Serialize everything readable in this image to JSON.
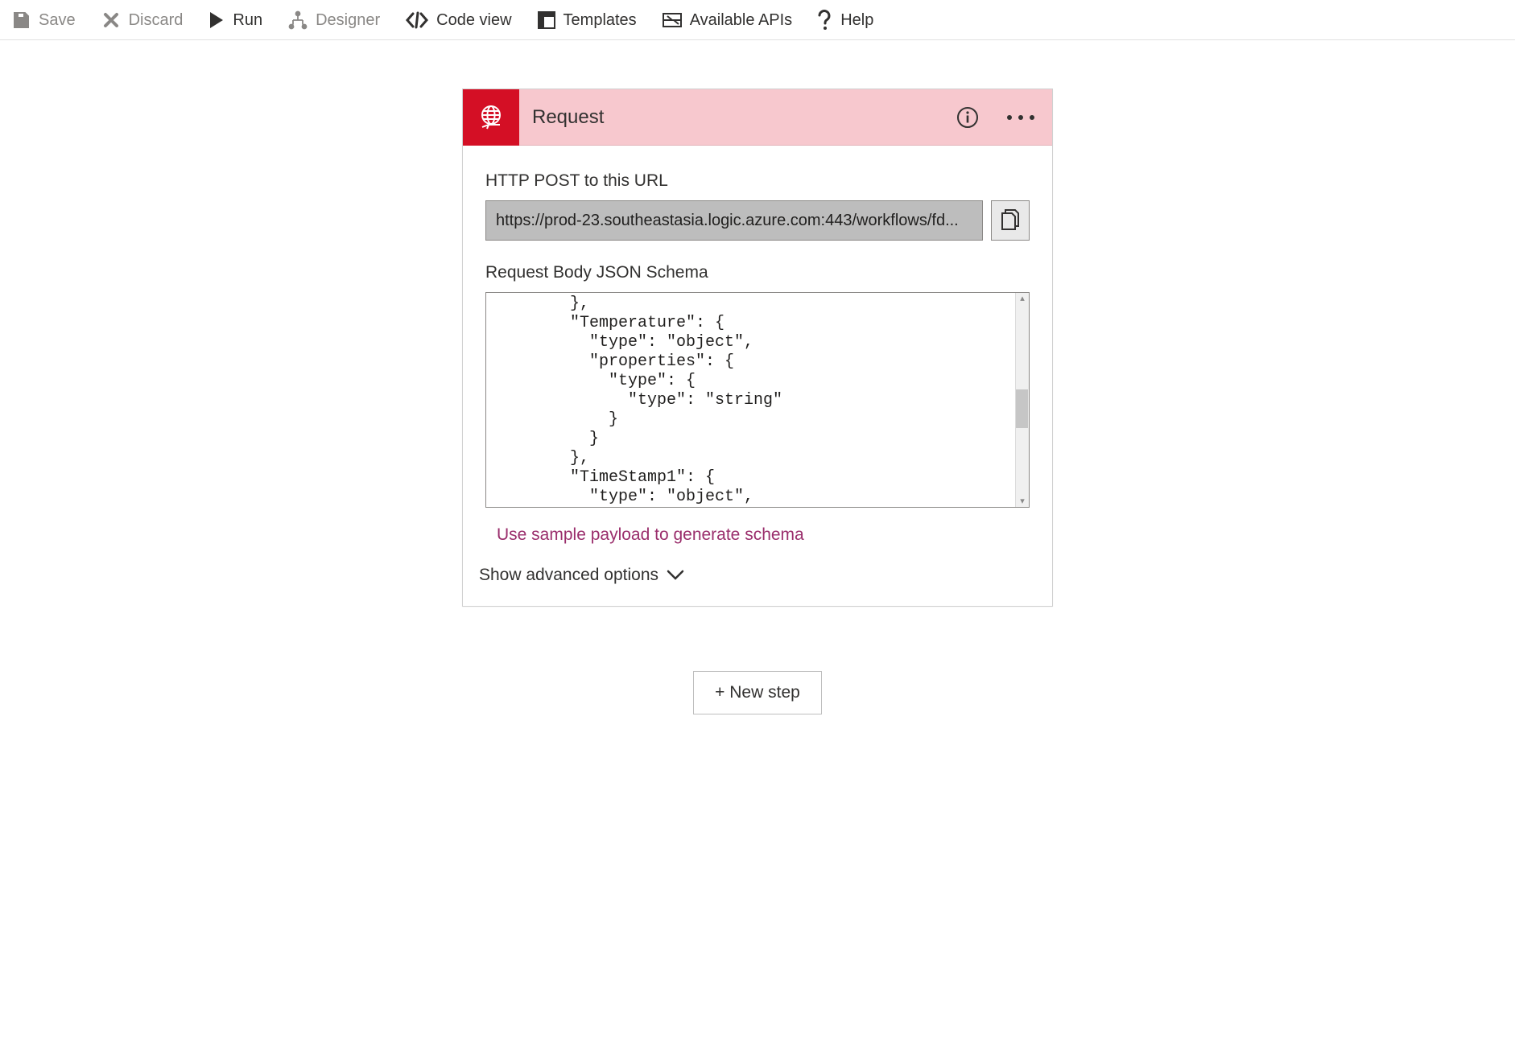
{
  "toolbar": {
    "save": "Save",
    "discard": "Discard",
    "run": "Run",
    "designer": "Designer",
    "code_view": "Code view",
    "templates": "Templates",
    "available_apis": "Available APIs",
    "help": "Help"
  },
  "card": {
    "title": "Request",
    "http_label": "HTTP POST to this URL",
    "http_url": "https://prod-23.southeastasia.logic.azure.com:443/workflows/fd...",
    "schema_label": "Request Body JSON Schema",
    "schema_text": "        },\n        \"Temperature\": {\n          \"type\": \"object\",\n          \"properties\": {\n            \"type\": {\n              \"type\": \"string\"\n            }\n          }\n        },\n        \"TimeStamp1\": {\n          \"type\": \"object\",",
    "sample_link": "Use sample payload to generate schema",
    "advanced_label": "Show advanced options"
  },
  "new_step": "+ New step",
  "palette": {
    "accent_red": "#d40f25",
    "header_pink": "#f7c8ce",
    "link_purple": "#9a2e6c"
  }
}
